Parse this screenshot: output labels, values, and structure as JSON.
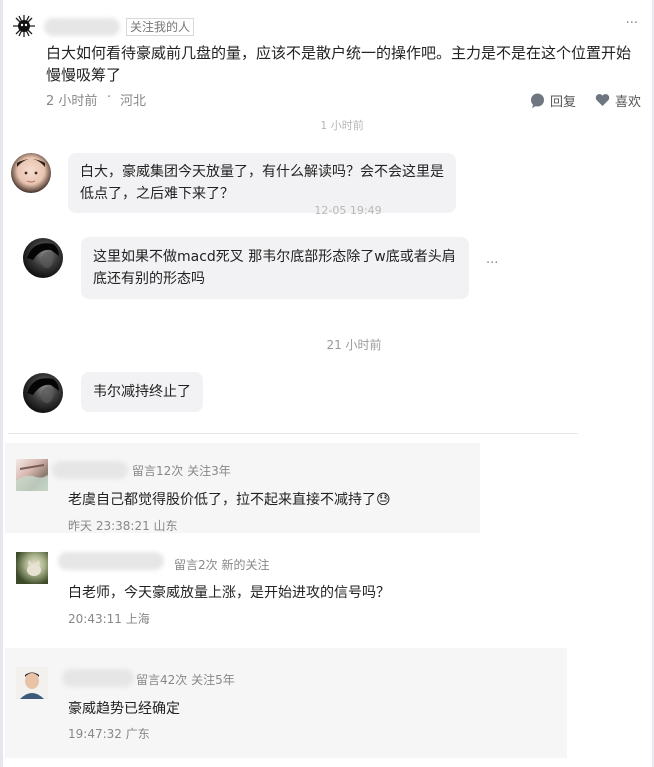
{
  "post": {
    "follow_tag": "关注我的人",
    "more": "···",
    "text": "白大如何看待豪威前几盘的量，应该不是散户统一的操作吧。主力是不是在这个位置开始慢慢吸筹了",
    "time": "2 小时前",
    "sep": "·",
    "location": "河北",
    "reply_label": "回复",
    "like_label": "喜欢"
  },
  "thread": {
    "faded_time_1": "1 小时前",
    "msg1": "白大，豪威集团今天放量了，有什么解读吗？会不会这里是低点了，之后难下来了？",
    "faded_time_2": "12-05 19:49",
    "msg2": "这里如果不做macd死叉 那韦尔底部形态除了w底或者头肩底还有别的形态吗",
    "msg2_more": "···",
    "time_3": "21 小时前",
    "msg3": "韦尔减持终止了"
  },
  "comments": [
    {
      "meta": "留言12次 关注3年",
      "text": "老虞自己都觉得股价低了，拉不起来直接不减持了",
      "emoji": "😓",
      "time": "昨天 23:38:21 山东"
    },
    {
      "meta": "留言2次 新的关注",
      "text": "白老师，今天豪威放量上涨，是开始进攻的信号吗？",
      "time": "20:43:11 上海"
    },
    {
      "meta": "留言42次 关注5年",
      "text": "豪威趋势已经确定",
      "time": "19:47:32 广东"
    }
  ],
  "colors": {
    "bubble_bg": "#f2f2f4",
    "comment_bg": "#f6f6f7",
    "meta_text": "#888888"
  }
}
